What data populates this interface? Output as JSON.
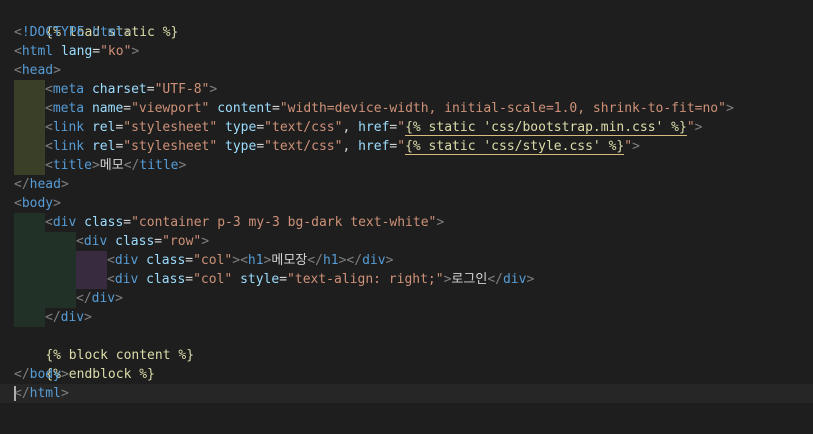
{
  "editor": {
    "language": "django-html",
    "colors": {
      "background": "#1e1e1e",
      "tag": "#569cd6",
      "attribute": "#9cdcfe",
      "string": "#ce9178",
      "template_tag": "#dcdcaa"
    },
    "lines": [
      "{% load static %}",
      "<!DOCTYPE html>",
      "<html lang=\"ko\">",
      "<head>",
      "<meta charset=\"UTF-8\">",
      "<meta name=\"viewport\" content=\"width=device-width, initial-scale=1.0, shrink-to-fit=no\">",
      "<link rel=\"stylesheet\" type=\"text/css\", href=\"{% static 'css/bootstrap.min.css' %}\">",
      "<link rel=\"stylesheet\" type=\"text/css\", href=\"{% static 'css/style.css' %}\">",
      "<title>메모</title>",
      "</head>",
      "<body>",
      "<div class=\"container p-3 my-3 bg-dark text-white\">",
      "<div class=\"row\">",
      "<div class=\"col\"><h1>메모장</h1></div>",
      "<div class=\"col\" style=\"text-align: right;\">로그인</div>",
      "</div>",
      "</div>",
      "{% block content %}",
      "{% endblock %}",
      "</body>",
      "</html>"
    ]
  }
}
